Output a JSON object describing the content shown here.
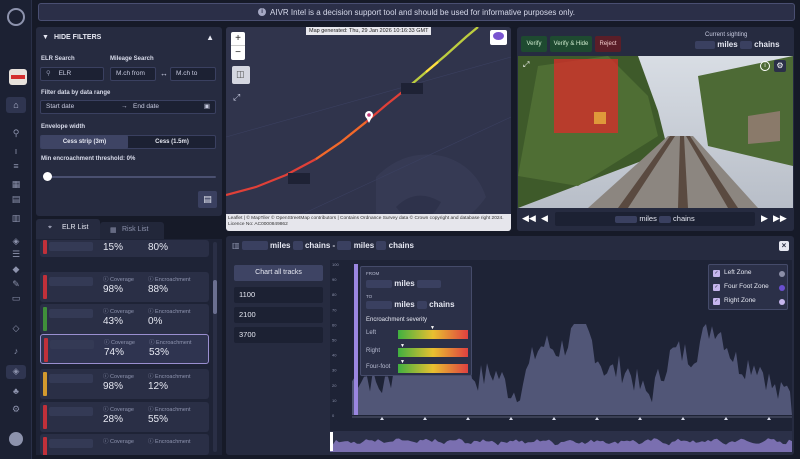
{
  "banner": {
    "text": "AIVR Intel is a decision support tool and should be used for informative purposes only."
  },
  "filters": {
    "header": "HIDE FILTERS",
    "elr_search_label": "ELR Search",
    "mileage_search_label": "Mileage Search",
    "elr_placeholder": "ELR",
    "mch_from_placeholder": "M.ch from",
    "mch_to_placeholder": "M.ch to",
    "date_range_label": "Filter data by data range",
    "start_date_placeholder": "Start date",
    "end_date_placeholder": "End date",
    "envelope_label": "Envelope width",
    "envelope_options": [
      "Cess strip (3m)",
      "Cess (1.5m)"
    ],
    "threshold_label": "Min encroachment threshold: 0%",
    "threshold_value": 0
  },
  "tabs": {
    "elr_list": "ELR List",
    "risk_list": "Risk List"
  },
  "list": {
    "coverage_caption": "Coverage",
    "encroachment_caption": "Encroachment",
    "rows": [
      {
        "coverage": "15%",
        "encroachment": "80%",
        "color": "#c0303a"
      },
      {
        "coverage": "98%",
        "encroachment": "88%",
        "color": "#c0303a"
      },
      {
        "coverage": "43%",
        "encroachment": "0%",
        "color": "#3f8f3a"
      },
      {
        "coverage": "74%",
        "encroachment": "53%",
        "color": "#c0303a"
      },
      {
        "coverage": "98%",
        "encroachment": "12%",
        "color": "#d39a2e"
      },
      {
        "coverage": "28%",
        "encroachment": "55%",
        "color": "#c0303a"
      },
      {
        "coverage": "",
        "encroachment": "",
        "color": "#c0303a"
      }
    ]
  },
  "map": {
    "generated": "Map generated: Thu, 29 Jan 2026 10:16:33 GMT",
    "zoom_in": "+",
    "zoom_out": "−",
    "attribution": "Leaflet | © MapTiler © OpenStreetMap contributors | Contains Ordnance Survey data © Crown copyright and database right 2024. Licence No: AC0000849862",
    "leaflet": "Leaflet"
  },
  "camera": {
    "verify": "Verify",
    "verify_hide": "Verify & Hide",
    "reject": "Reject",
    "current_sighting": "Current sighting",
    "miles": "miles",
    "chains": "chains"
  },
  "lower": {
    "miles": "miles",
    "chains": "chains",
    "separator": "-",
    "chart_all": "Chart all tracks",
    "tracks": [
      "1100",
      "2100",
      "3700"
    ],
    "tooltip": {
      "from": "FROM",
      "to": "TO",
      "severity": "Encroachment severity",
      "left": "Left",
      "right": "Right",
      "four_foot": "Four-foot"
    },
    "legend": [
      {
        "label": "Left Zone",
        "color": "#8c8fa8"
      },
      {
        "label": "Four Foot Zone",
        "color": "#6a4fd0"
      },
      {
        "label": "Right Zone",
        "color": "#c6b6ee"
      }
    ],
    "y_axis_ticks": [
      "100",
      "90",
      "80",
      "70",
      "60",
      "50",
      "40",
      "30",
      "20",
      "10",
      "0"
    ]
  }
}
